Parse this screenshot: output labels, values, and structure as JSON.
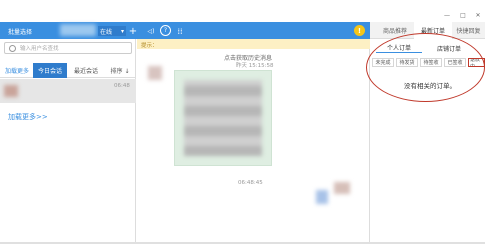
{
  "window": {
    "minimize_label": "—",
    "maximize_label": "□",
    "close_label": "✕"
  },
  "topbar": {
    "batch_label": "批量选择",
    "status_label": "在线",
    "status_arrow": "▾",
    "add_label": "+",
    "sound_label": "◁)",
    "help_label": "?",
    "grid_label": "⁞⁞",
    "warning_label": "!",
    "product_recommend": "商品推荐",
    "latest_orders": "最新订单",
    "quick_reply": "快捷回复"
  },
  "sidebar": {
    "search_placeholder": "输入用户名查找",
    "tabs": [
      "加载更多",
      "今日会话",
      "最近会话",
      "排序 ↓"
    ],
    "conversation_time": "06:48",
    "load_more_link": "加载更多>>"
  },
  "chat": {
    "hint_label": "提示：",
    "history_link": "点击获取历史消息",
    "timestamp_top": "昨天 15:15:58",
    "timestamp_bottom": "06:48:45"
  },
  "orders": {
    "tabs": [
      "个人订单",
      "店铺订单"
    ],
    "filters": [
      "未完成",
      "待发货",
      "待签收",
      "已签收",
      "退款中"
    ],
    "empty_message": "没有相关的订单。"
  },
  "colors": {
    "accent": "#3a8fe0",
    "highlight": "#c0392b",
    "warning": "#f5c518"
  }
}
